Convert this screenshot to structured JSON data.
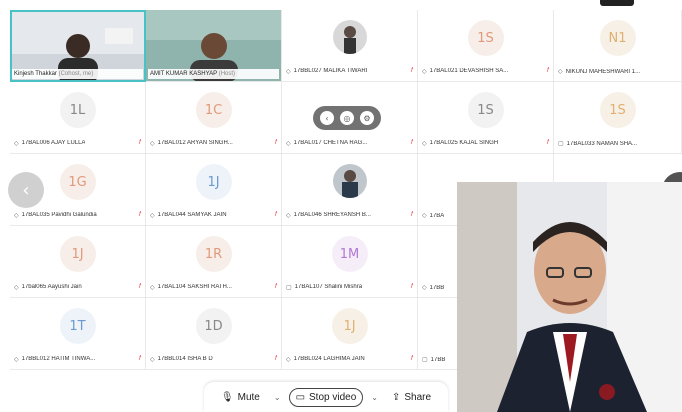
{
  "tiles": [
    {
      "label": "Kinjesh Thakkar",
      "suffix": "(Cohost, me)",
      "initials": ""
    },
    {
      "label": "AMIT KUMAR KASHYAP",
      "suffix": "(Host)",
      "initials": ""
    },
    {
      "label": "17BBL027 MALIKA TIWARI",
      "initials": ""
    },
    {
      "label": "17BAL021 DEVASHISH SA...",
      "initials": "1S"
    },
    {
      "label": "NIKUNJ MAHESHWARI 1...",
      "initials": "N1"
    },
    {
      "label": "17BAL006 AJAY LULLA",
      "initials": "1L"
    },
    {
      "label": "17BAL012 ARYAN SINGH...",
      "initials": "1C"
    },
    {
      "label": "17BAL017 CHETNA RAG...",
      "initials": ""
    },
    {
      "label": "17BAL025 KAJAL SINGH",
      "initials": "1S"
    },
    {
      "label": "17BAL033 NAMAN SHA...",
      "initials": "1S"
    },
    {
      "label": "17BAL035 Pavidhi Galundia",
      "initials": "1G"
    },
    {
      "label": "17BAL044 SAMYAK JAIN",
      "initials": "1J"
    },
    {
      "label": "17BAL046 SHREYANSH B...",
      "initials": ""
    },
    {
      "label": "17BA",
      "initials": ""
    },
    {
      "label": "17bal065 Aayushi Jain",
      "initials": "1J"
    },
    {
      "label": "17BAL104 SAKSHI RATH...",
      "initials": "1R"
    },
    {
      "label": "17BAL107 Shalini Mishra",
      "initials": "1M"
    },
    {
      "label": "17BB",
      "initials": ""
    },
    {
      "label": "17BBL012 HATIM TINWA...",
      "initials": "1T"
    },
    {
      "label": "17BBL014 ISHA B D",
      "initials": "1D"
    },
    {
      "label": "17BBL024 LAGHIMA JAIN",
      "initials": "1J"
    },
    {
      "label": "17BB",
      "initials": ""
    }
  ],
  "toolbar": {
    "mute_label": "Mute",
    "stop_video_label": "Stop video",
    "share_label": "Share"
  },
  "colors": {
    "active_border": "#49c2c6",
    "initials_text": "#e09a7a",
    "muted_mic": "#e44444"
  }
}
